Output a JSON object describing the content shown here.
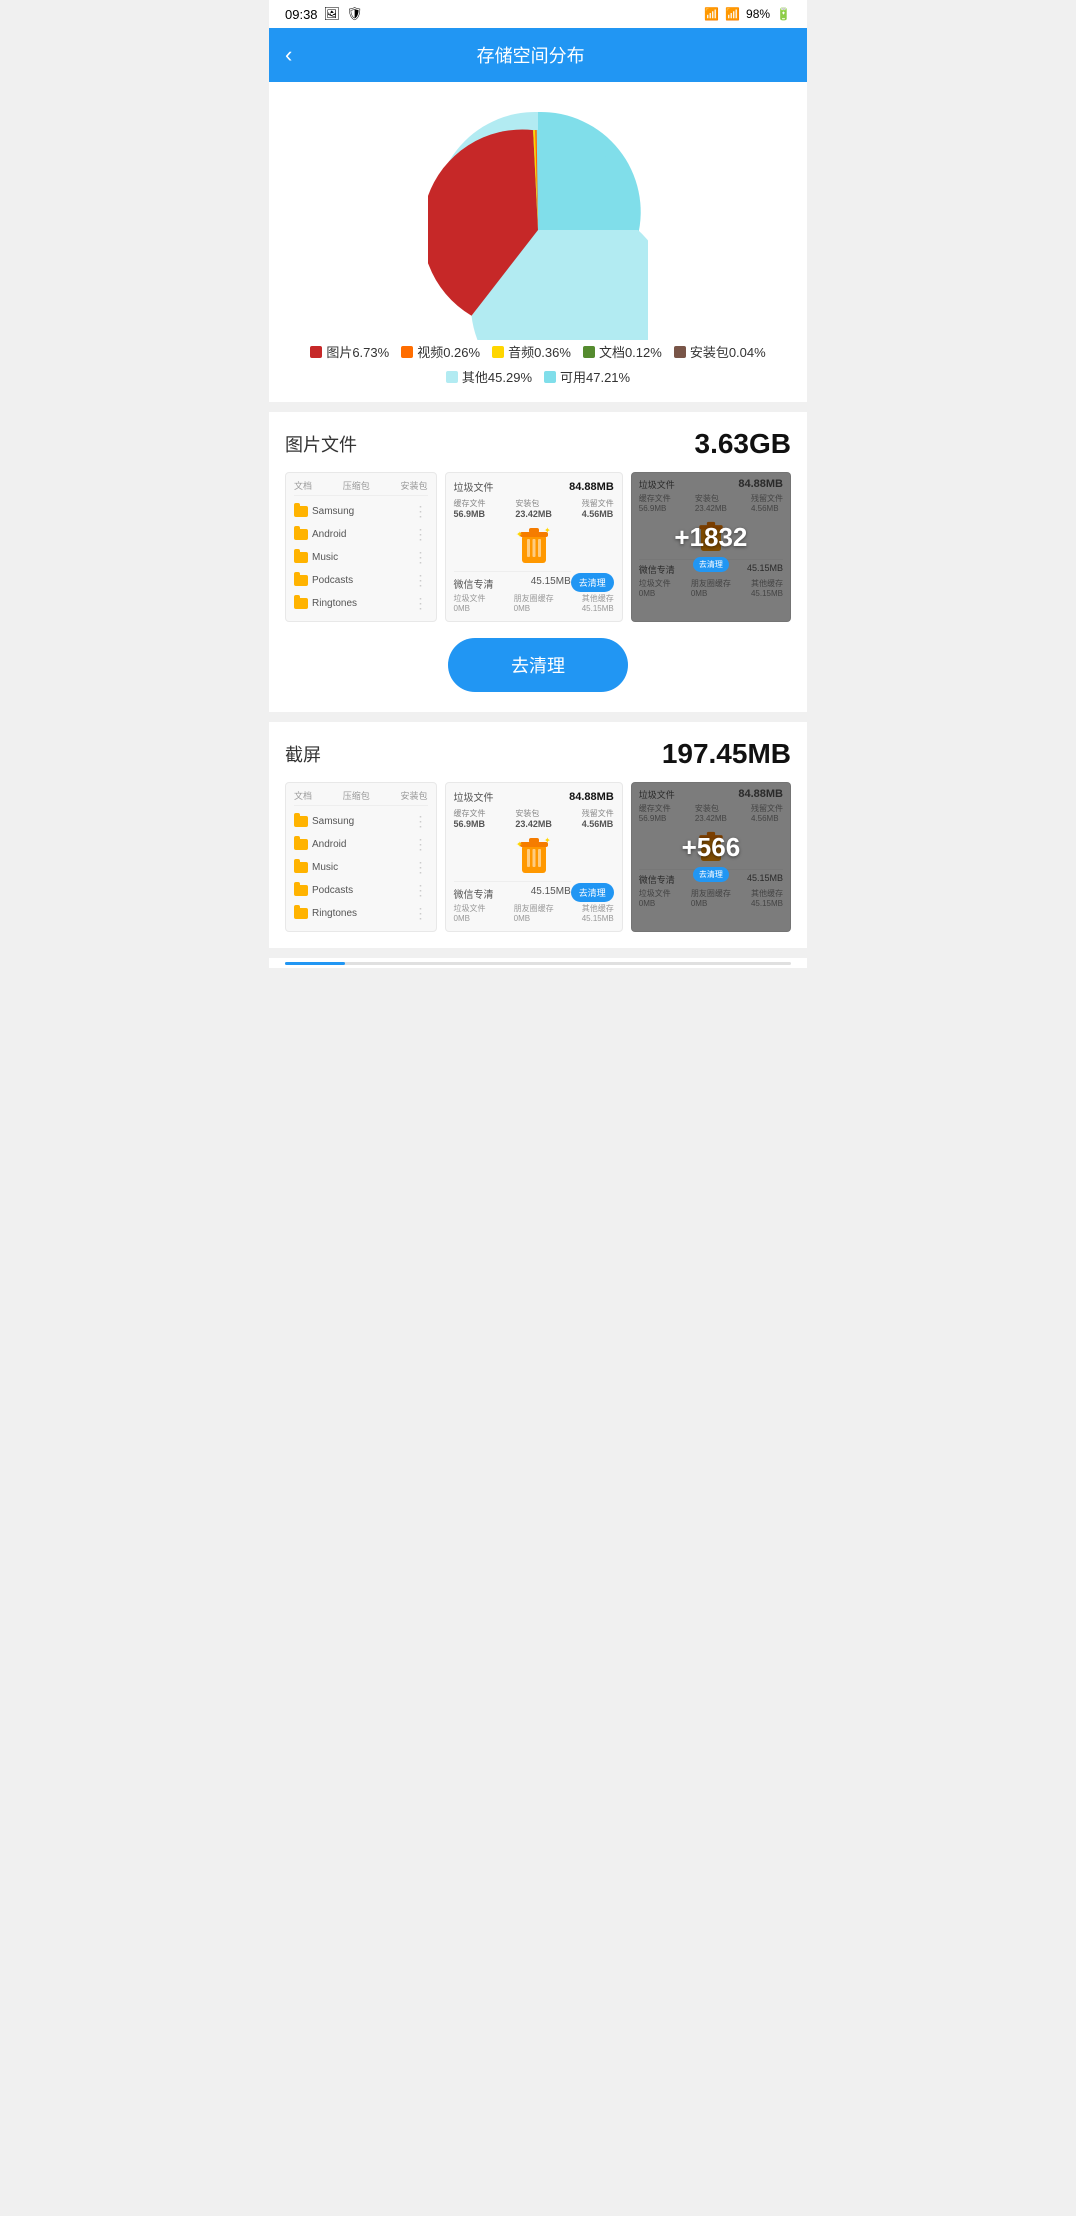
{
  "statusBar": {
    "time": "09:38",
    "battery": "98%"
  },
  "header": {
    "backLabel": "‹",
    "title": "存储空间分布"
  },
  "chart": {
    "legend": [
      {
        "label": "图片6.73%",
        "color": "#C62828"
      },
      {
        "label": "视频0.26%",
        "color": "#FF6D00"
      },
      {
        "label": "音频0.36%",
        "color": "#FFD600"
      },
      {
        "label": "文档0.12%",
        "color": "#558B2F"
      },
      {
        "label": "安装包0.04%",
        "color": "#795548"
      },
      {
        "label": "其他45.29%",
        "color": "#B2EBF2"
      },
      {
        "label": "可用47.21%",
        "color": "#80DEEA"
      }
    ]
  },
  "sections": [
    {
      "id": "pics",
      "title": "图片文件",
      "size": "3.63GB",
      "fileList": {
        "headers": [
          "文档",
          "压缩包",
          "安装包"
        ],
        "items": [
          "Samsung",
          "Android",
          "Music",
          "Podcasts",
          "Ringtones"
        ]
      },
      "junkCard": {
        "title": "垃圾文件",
        "totalSize": "84.88MB",
        "subItems": [
          {
            "label": "缓存文件",
            "value": "56.9MB"
          },
          {
            "label": "安装包",
            "value": "23.42MB"
          },
          {
            "label": "残留文件",
            "value": "4.56MB"
          }
        ],
        "cleanBtn": "去清理",
        "wechatTitle": "微信专清",
        "wechatSize": "45.15MB",
        "wechatSubs": [
          {
            "label": "垃圾文件",
            "value": "0MB"
          },
          {
            "label": "朋友圈缓存",
            "value": "0MB"
          },
          {
            "label": "其他缓存",
            "value": "45.15MB"
          }
        ]
      },
      "plusCard": {
        "number": "+1832",
        "cleanBtn": "去清理"
      },
      "bigCleanBtn": "去清理"
    },
    {
      "id": "screenshots",
      "title": "截屏",
      "size": "197.45MB",
      "fileList": {
        "headers": [
          "文档",
          "压缩包",
          "安装包"
        ],
        "items": [
          "Samsung",
          "Android",
          "Music",
          "Podcasts",
          "Ringtones"
        ]
      },
      "junkCard": {
        "title": "垃圾文件",
        "totalSize": "84.88MB",
        "subItems": [
          {
            "label": "缓存文件",
            "value": "56.9MB"
          },
          {
            "label": "安装包",
            "value": "23.42MB"
          },
          {
            "label": "残留文件",
            "value": "4.56MB"
          }
        ],
        "cleanBtn": "去清理",
        "wechatTitle": "微信专清",
        "wechatSize": "45.15MB",
        "wechatSubs": [
          {
            "label": "垃圾文件",
            "value": "0MB"
          },
          {
            "label": "朋友圈缓存",
            "value": "0MB"
          },
          {
            "label": "其他缓存",
            "value": "45.15MB"
          }
        ]
      },
      "plusCard": {
        "number": "+566",
        "cleanBtn": "去清理"
      }
    }
  ]
}
